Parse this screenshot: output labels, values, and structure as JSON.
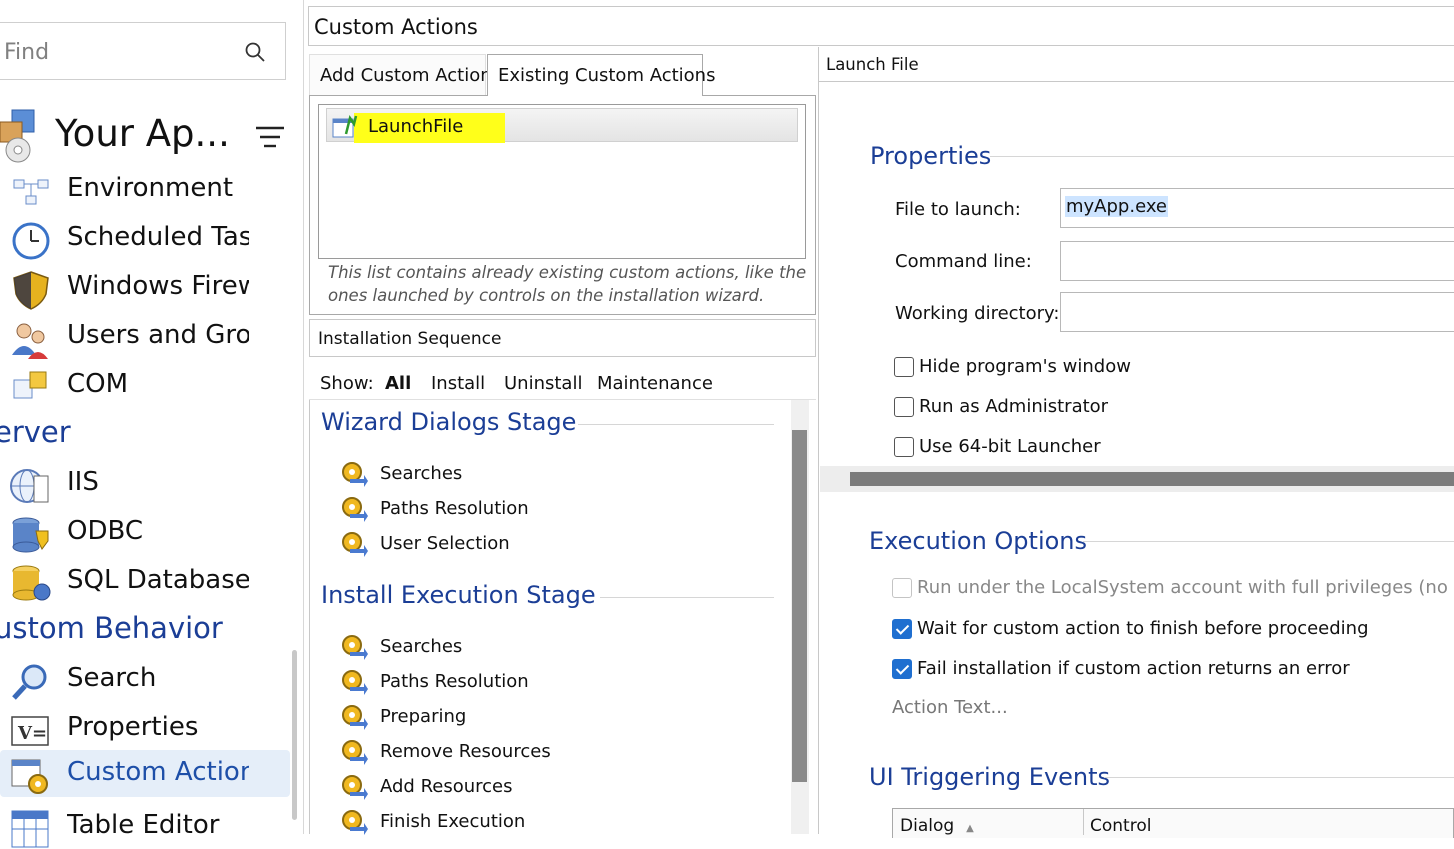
{
  "sidebar": {
    "search_placeholder": "Find",
    "app_title": "Your Ap...",
    "items_top": [
      {
        "label": "Environment",
        "icon": "environment-icon"
      },
      {
        "label": "Scheduled Task",
        "icon": "clock-icon"
      },
      {
        "label": "Windows Firew",
        "icon": "shield-icon"
      },
      {
        "label": "Users and Grou",
        "icon": "users-icon"
      },
      {
        "label": "COM",
        "icon": "puzzle-icon"
      }
    ],
    "section_server": "erver",
    "items_server": [
      {
        "label": "IIS",
        "icon": "iis-icon"
      },
      {
        "label": "ODBC",
        "icon": "odbc-icon"
      },
      {
        "label": "SQL Databases",
        "icon": "database-icon"
      }
    ],
    "section_custom": "ustom Behavior",
    "items_custom": [
      {
        "label": "Search",
        "icon": "magnifier-icon"
      },
      {
        "label": "Properties",
        "icon": "properties-icon"
      },
      {
        "label": "Custom Action",
        "icon": "custom-action-icon",
        "selected": true
      },
      {
        "label": "Table Editor",
        "icon": "table-icon"
      }
    ]
  },
  "main": {
    "title": "Custom Actions",
    "tabs": [
      {
        "label": "Add Custom Action",
        "active": false
      },
      {
        "label": "Existing Custom Actions",
        "active": true
      }
    ],
    "existing_list": [
      {
        "label": "LaunchFile",
        "highlight": "#ffff1a"
      }
    ],
    "list_hint": "This list contains already existing custom actions, like the ones launched by controls on the installation wizard.",
    "sequence": {
      "header": "Installation Sequence",
      "show_label": "Show:",
      "filters": [
        "All",
        "Install",
        "Uninstall",
        "Maintenance"
      ],
      "active_filter": "All",
      "stages": [
        {
          "title": "Wizard Dialogs Stage",
          "items": [
            "Searches",
            "Paths Resolution",
            "User Selection"
          ]
        },
        {
          "title": "Install Execution Stage",
          "items": [
            "Searches",
            "Paths Resolution",
            "Preparing",
            "Remove Resources",
            "Add Resources",
            "Finish Execution"
          ]
        }
      ]
    }
  },
  "properties_panel": {
    "header": "Launch File",
    "properties_title": "Properties",
    "file_to_launch_label": "File to launch:",
    "file_to_launch_value": "myApp.exe",
    "command_line_label": "Command line:",
    "command_line_value": "",
    "working_dir_label": "Working directory:",
    "working_dir_value": "",
    "options": [
      {
        "label": "Hide program's window",
        "checked": false
      },
      {
        "label": "Run as Administrator",
        "checked": false
      },
      {
        "label": "Use 64-bit Launcher",
        "checked": false
      }
    ],
    "execution_title": "Execution Options",
    "execution_options": [
      {
        "label": "Run under the LocalSystem account with full privileges (no impe",
        "checked": false,
        "disabled": true
      },
      {
        "label": "Wait for custom action to finish before proceeding",
        "checked": true,
        "disabled": false
      },
      {
        "label": "Fail installation if custom action returns an error",
        "checked": true,
        "disabled": false
      }
    ],
    "action_text_link": "Action Text...",
    "ui_events_title": "UI Triggering Events",
    "grid_columns": [
      "Dialog",
      "Control"
    ]
  },
  "colors": {
    "accent": "#1b3e96",
    "selection": "#e5eef9",
    "highlight": "#ffff1a",
    "check": "#1f6fd0"
  }
}
